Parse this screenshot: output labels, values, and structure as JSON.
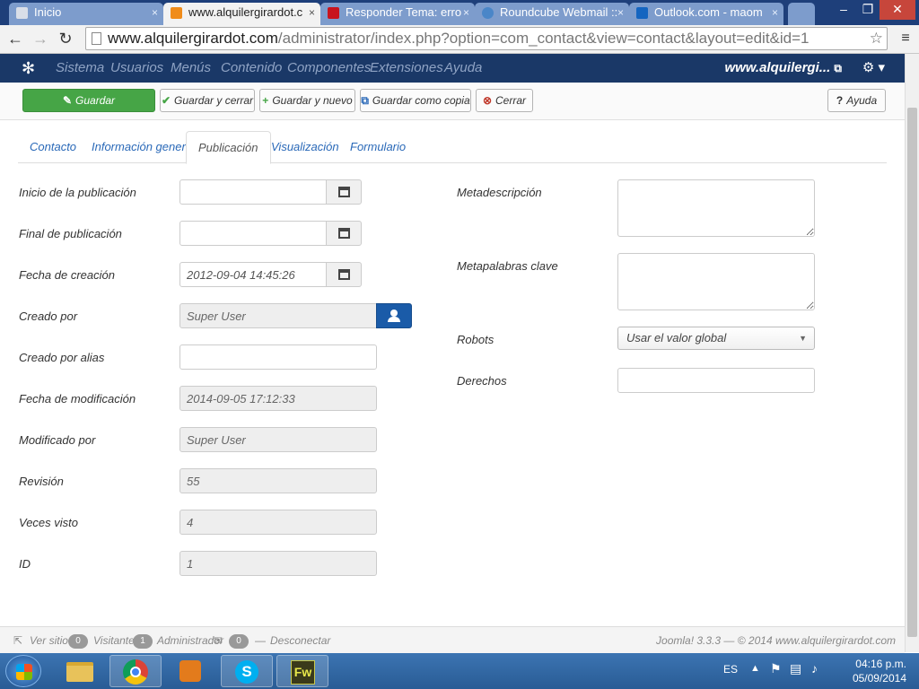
{
  "browser": {
    "tabs": [
      {
        "title": "Inicio",
        "favicon_color": "#d9dee8",
        "active": false
      },
      {
        "title": "www.alquilergirardot.c",
        "favicon_color": "#f08c1a",
        "active": true
      },
      {
        "title": "Responder Tema: erro",
        "favicon_color": "#c8141e",
        "active": false
      },
      {
        "title": "Roundcube Webmail ::",
        "favicon_color": "#4a86c8",
        "active": false
      },
      {
        "title": "Outlook.com - maom",
        "favicon_color": "#1565c0",
        "active": false
      }
    ],
    "tab_close": "×",
    "window_controls": [
      "–",
      "❐",
      "✕"
    ],
    "url_host": "www.alquilergirardot.com",
    "url_path": "/administrator/index.php?option=com_contact&view=contact&layout=edit&id=1"
  },
  "admin_nav": {
    "items": [
      "Sistema",
      "Usuarios",
      "Menús",
      "Contenido",
      "Componentes",
      "Extensiones",
      "Ayuda"
    ],
    "site_link": "www.alquilergi...",
    "external_icon": "⧉",
    "settings_icon": "⚙ ▾"
  },
  "toolbar": {
    "save": "Guardar",
    "save_close": "Guardar y cerrar",
    "save_new": "Guardar y nuevo",
    "save_copy": "Guardar como copia",
    "close": "Cerrar",
    "help": "Ayuda"
  },
  "tabs": [
    "Contacto",
    "Información general",
    "Publicación",
    "Visualización",
    "Formulario"
  ],
  "active_tab": "Publicación",
  "form_left": {
    "publish_up": {
      "label": "Inicio de la publicación",
      "value": ""
    },
    "publish_down": {
      "label": "Final de publicación",
      "value": ""
    },
    "created": {
      "label": "Fecha de creación",
      "value": "2012-09-04 14:45:26"
    },
    "created_by": {
      "label": "Creado por",
      "value": "Super User"
    },
    "created_by_alias": {
      "label": "Creado por alias",
      "value": ""
    },
    "modified": {
      "label": "Fecha de modificación",
      "value": "2014-09-05 17:12:33"
    },
    "modified_by": {
      "label": "Modificado por",
      "value": "Super User"
    },
    "version": {
      "label": "Revisión",
      "value": "55"
    },
    "hits": {
      "label": "Veces visto",
      "value": "4"
    },
    "id": {
      "label": "ID",
      "value": "1"
    }
  },
  "form_right": {
    "metadesc": {
      "label": "Metadescripción",
      "value": ""
    },
    "metakey": {
      "label": "Metapalabras clave",
      "value": ""
    },
    "robots": {
      "label": "Robots",
      "value": "Usar el valor global"
    },
    "rights": {
      "label": "Derechos",
      "value": ""
    }
  },
  "status_bar": {
    "view_site": "Ver sitio",
    "visitors_count": "0",
    "visitors": "Visitantes",
    "admins_count": "1",
    "admins": "Administrador",
    "messages_count": "0",
    "logout": "Desconectar",
    "copyright": "Joomla! 3.3.3 — © 2014 www.alquilergirardot.com"
  },
  "taskbar": {
    "language": "ES",
    "time": "04:16 p.m.",
    "date": "05/09/2014",
    "fw_label": "Fw"
  }
}
